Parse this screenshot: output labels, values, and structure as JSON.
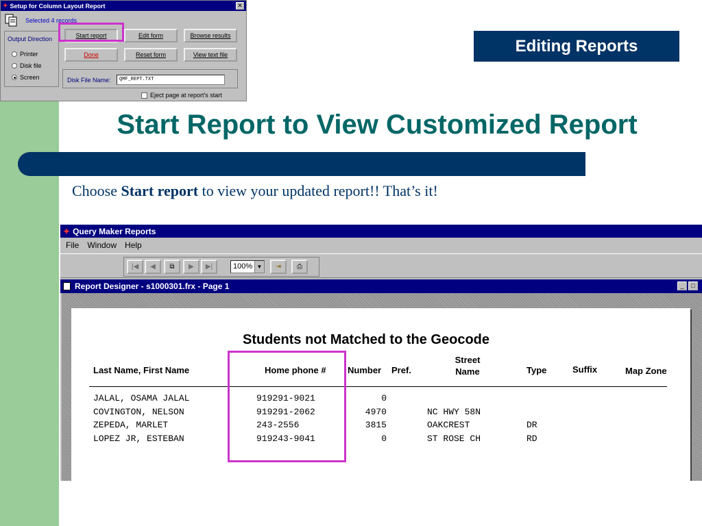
{
  "slide": {
    "banner": "Editing Reports",
    "title": "Start Report to View Customized Report",
    "instruction_pre": "Choose ",
    "instruction_bold": "Start report",
    "instruction_post": " to view your updated report!!  That’s it!"
  },
  "setup_dialog": {
    "title": "Setup for Column Layout Report",
    "selected_text": "Selected 4 records",
    "output_direction": {
      "label": "Output Direction",
      "options": [
        "Printer",
        "Disk file",
        "Screen"
      ],
      "selected": "Screen"
    },
    "buttons": {
      "start_report": "Start report",
      "edit_form": "Edit form",
      "browse_results": "Browse results",
      "done": "Done",
      "reset_form": "Reset form",
      "view_text_file": "View text file"
    },
    "disk_file_label": "Disk File Name:",
    "disk_file_value": "QMF_REPT.TXT",
    "eject_label": "Eject page at report's start"
  },
  "query_maker": {
    "title": "Query Maker Reports",
    "menu": [
      "File",
      "Window",
      "Help"
    ],
    "zoom": "100%",
    "designer_title": "Report Designer - s1000301.frx - Page 1",
    "report": {
      "title": "Students not Matched to the Geocode",
      "columns": {
        "name": "Last Name, First Name",
        "phone": "Home phone #",
        "number": "Number",
        "pref": "Pref.",
        "street_1": "Street",
        "street_2": "Name",
        "type": "Type",
        "suffix": "Suffix",
        "map_zone": "Map Zone"
      },
      "rows": [
        {
          "name": "JALAL, OSAMA JALAL",
          "phone": "919291-9021",
          "number": "0",
          "street": "",
          "type": ""
        },
        {
          "name": "COVINGTON, NELSON",
          "phone": "919291-2062",
          "number": "4970",
          "street": "NC HWY 58N",
          "type": ""
        },
        {
          "name": "ZEPEDA, MARLET",
          "phone": "243-2556",
          "number": "3815",
          "street": "OAKCREST",
          "type": "DR"
        },
        {
          "name": "LOPEZ JR, ESTEBAN",
          "phone": "919243-9041",
          "number": "0",
          "street": "ST ROSE CH",
          "type": "RD"
        }
      ]
    }
  },
  "colors": {
    "band": "#99cc99",
    "navy": "#003366",
    "title_teal": "#006666",
    "highlight": "#cc33cc"
  }
}
